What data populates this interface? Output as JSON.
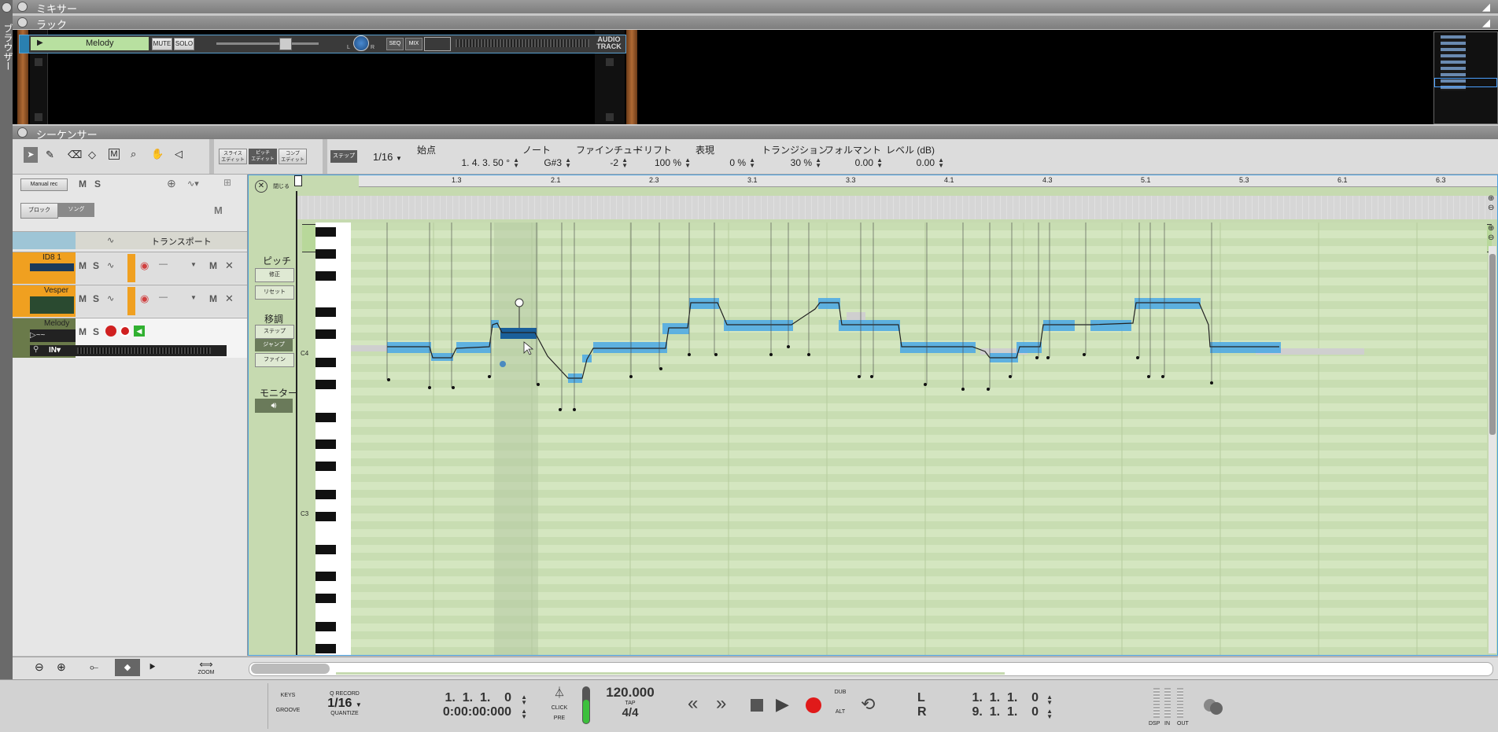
{
  "panels": {
    "mixer": "ミキサー",
    "rack": "ラック",
    "browser": "ブラウザー",
    "sequencer": "シーケンサー"
  },
  "rack": {
    "device_name": "Melody",
    "mute": "MUTE",
    "solo": "SOLO",
    "seq": "SEQ",
    "mix": "MIX",
    "audio_track": [
      "AUDIO",
      "TRACK"
    ],
    "pan_l": "L",
    "pan_r": "R"
  },
  "toolbar": {
    "edit_modes": [
      [
        "スライス",
        "エディット"
      ],
      [
        "ピッチ",
        "エディット"
      ],
      [
        "コンプ",
        "エディット"
      ]
    ],
    "step_label": "ステップ",
    "snap_value": "1/16",
    "fields": [
      {
        "label": "始点",
        "value": "1.  4.  3.  50 °"
      },
      {
        "label": "ノート",
        "value": "G#3"
      },
      {
        "label": "ファインチュー",
        "value": "-2"
      },
      {
        "label": "ドリフト",
        "value": "100 %"
      },
      {
        "label": "表現",
        "value": "0 %"
      },
      {
        "label": "トランジション",
        "value": "30 %"
      },
      {
        "label": "フォルマント",
        "value": "0.00"
      },
      {
        "label": "レベル (dB)",
        "value": "0.00"
      }
    ]
  },
  "tracklist": {
    "manual_rec": "Manual rec",
    "m": "M",
    "s": "S",
    "block": "ブロック",
    "song": "ソング",
    "transport": "トランスポート",
    "tracks": [
      {
        "name": "ID8 1",
        "color": "#f0a020"
      },
      {
        "name": "Vesper",
        "color": "#f0a020"
      },
      {
        "name": "Melody",
        "color": "#6a7a4a"
      }
    ],
    "input": "IN▾"
  },
  "editor": {
    "close_label": "閉じる",
    "ruler": [
      "1.3",
      "2.1",
      "2.3",
      "3.1",
      "3.3",
      "4.1",
      "4.3",
      "5.1",
      "5.3",
      "6.1",
      "6.3"
    ],
    "pitch_label": "ピッチ",
    "pitch_buttons": [
      "修正",
      "リセット"
    ],
    "transpose_label": "移調",
    "transpose_buttons": [
      "ステップ",
      "ジャンプ",
      "ファイン"
    ],
    "monitor_label": "モニター",
    "key_labels": [
      "C4",
      "C3"
    ]
  },
  "transport": {
    "keys": "KEYS",
    "groove": "GROOVE",
    "q_record": "Q RECORD",
    "quantize_value": "1/16",
    "quantize": "QUANTIZE",
    "position_bars": "1.  1.  1.    0",
    "position_time": "0:00:00:000",
    "click": "CLICK",
    "pre": "PRE",
    "tempo": "120.000",
    "tap": "TAP",
    "signature": "4/4",
    "dub": "DUB",
    "alt": "ALT",
    "loop_l_label": "L",
    "loop_l": "1.  1.  1.    0",
    "loop_r_label": "R",
    "loop_r": "9.  1.  1.    0",
    "dsp": "DSP",
    "in": "IN",
    "out": "OUT",
    "zoom": "ZOOM"
  }
}
